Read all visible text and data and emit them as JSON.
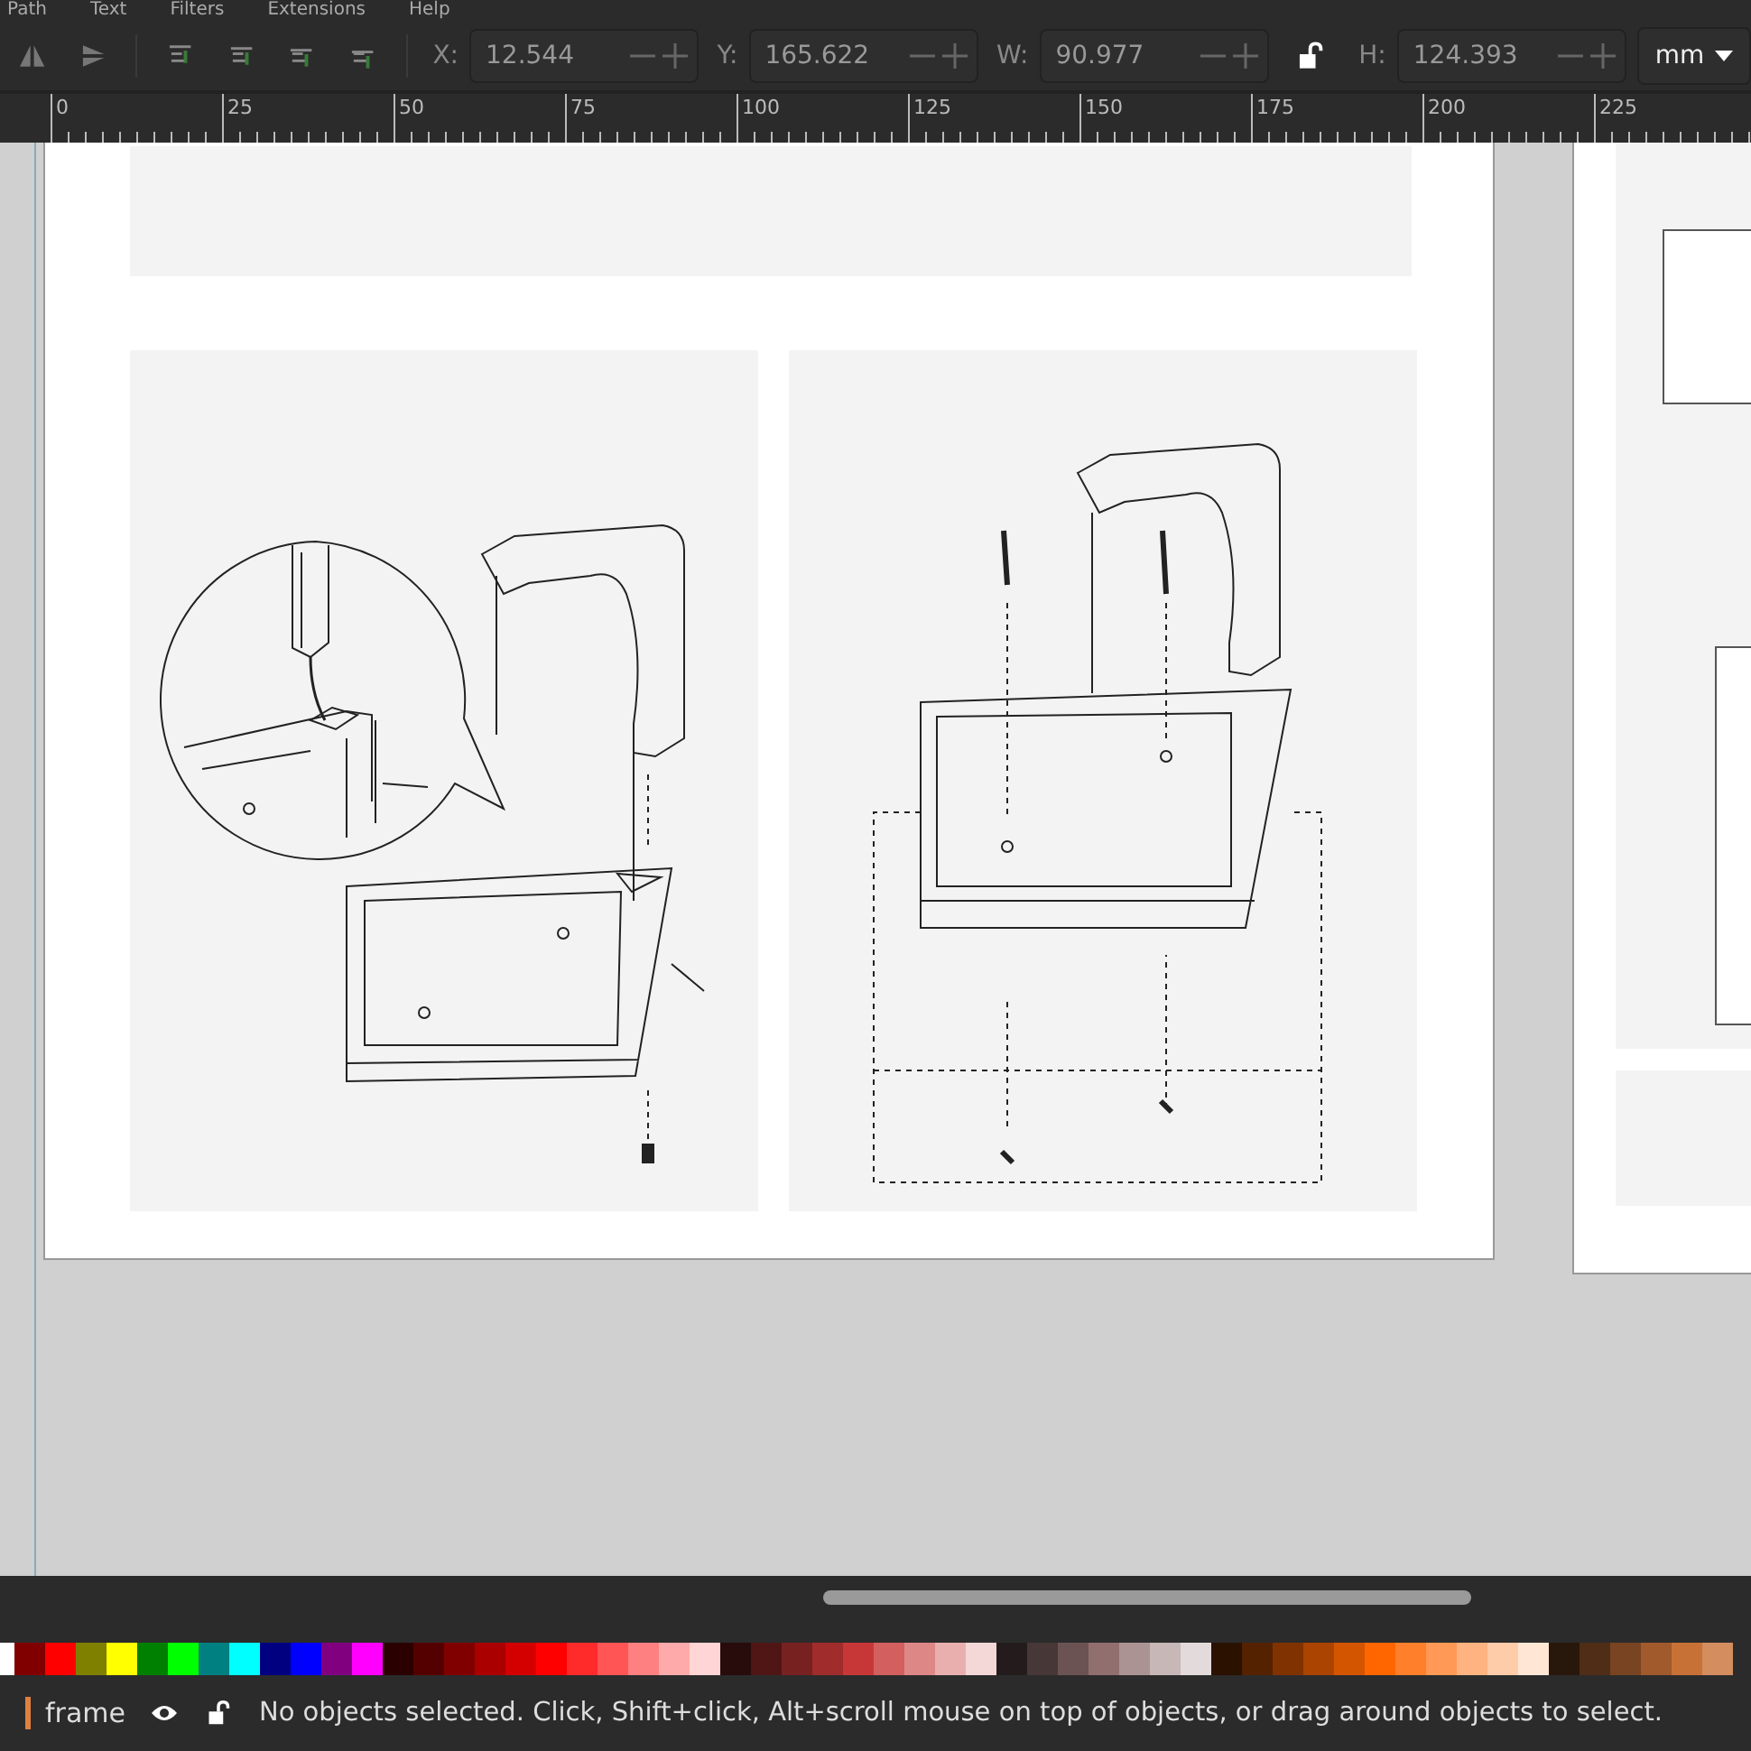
{
  "menubar": [
    "Path",
    "Text",
    "Filters",
    "Extensions",
    "Help"
  ],
  "toolbar": {
    "fields": [
      {
        "label": "X:",
        "value": "12.544"
      },
      {
        "label": "Y:",
        "value": "165.622"
      },
      {
        "label": "W:",
        "value": "90.977"
      },
      {
        "label": "H:",
        "value": "124.393"
      }
    ],
    "unit": "mm"
  },
  "ruler": {
    "labels": [
      "0",
      "25",
      "50",
      "75",
      "100",
      "125",
      "150",
      "175",
      "200",
      "225"
    ]
  },
  "palette": [
    {
      "color": "#ffffff"
    },
    {
      "color": "#800000"
    },
    {
      "color": "#ff0000"
    },
    {
      "color": "#808000"
    },
    {
      "color": "#ffff00"
    },
    {
      "color": "#008000"
    },
    {
      "color": "#00ff00"
    },
    {
      "color": "#008080"
    },
    {
      "color": "#00ffff"
    },
    {
      "color": "#000080"
    },
    {
      "color": "#0000ff"
    },
    {
      "color": "#800080"
    },
    {
      "color": "#ff00ff"
    },
    {
      "color": "#2b0000"
    },
    {
      "color": "#550000"
    },
    {
      "color": "#800000"
    },
    {
      "color": "#aa0000"
    },
    {
      "color": "#d40000"
    },
    {
      "color": "#ff0000"
    },
    {
      "color": "#ff2a2a"
    },
    {
      "color": "#ff5555"
    },
    {
      "color": "#ff8080"
    },
    {
      "color": "#ffaaaa"
    },
    {
      "color": "#ffd5d5"
    },
    {
      "color": "#280b0b"
    },
    {
      "color": "#501616"
    },
    {
      "color": "#782121"
    },
    {
      "color": "#a02c2c"
    },
    {
      "color": "#c83737"
    },
    {
      "color": "#d35f5f"
    },
    {
      "color": "#de8787"
    },
    {
      "color": "#e9afaf"
    },
    {
      "color": "#f4d7d7"
    },
    {
      "color": "#241c1c"
    },
    {
      "color": "#483737"
    },
    {
      "color": "#6c5353"
    },
    {
      "color": "#916f6f"
    },
    {
      "color": "#ac9393"
    },
    {
      "color": "#c8b7b7"
    },
    {
      "color": "#e3dbdb"
    },
    {
      "color": "#2b1100"
    },
    {
      "color": "#552200"
    },
    {
      "color": "#803300"
    },
    {
      "color": "#aa4400"
    },
    {
      "color": "#d45500"
    },
    {
      "color": "#ff6600"
    },
    {
      "color": "#ff7f2a"
    },
    {
      "color": "#ff9955"
    },
    {
      "color": "#ffb380"
    },
    {
      "color": "#ffccaa"
    },
    {
      "color": "#ffe6d5"
    },
    {
      "color": "#28170b"
    },
    {
      "color": "#502d16"
    },
    {
      "color": "#784421"
    },
    {
      "color": "#a05a2c"
    },
    {
      "color": "#c87137"
    },
    {
      "color": "#d38d5f"
    }
  ],
  "status_bar": {
    "layer": "frame",
    "message": "No objects selected. Click, Shift+click, Alt+scroll mouse on top of objects, or drag around objects to select."
  }
}
